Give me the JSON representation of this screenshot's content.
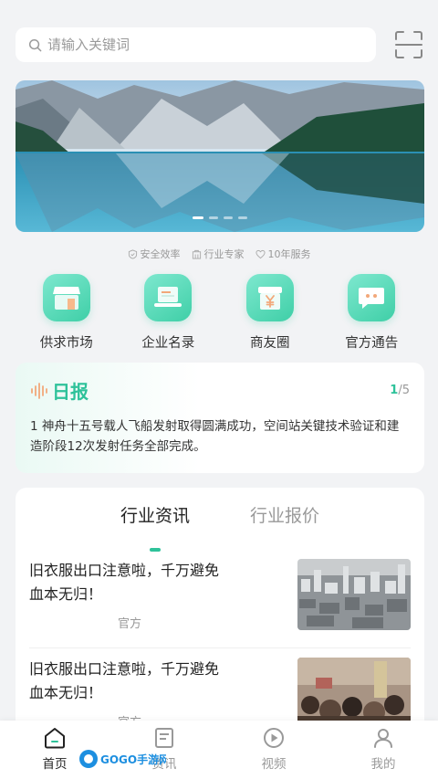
{
  "search": {
    "placeholder": "请输入关键词",
    "scan_icon": "scan-icon"
  },
  "banner": {
    "slide_count": 4,
    "active_slide": 1
  },
  "features": [
    {
      "icon": "shield-icon",
      "label": "安全效率"
    },
    {
      "icon": "building-icon",
      "label": "行业专家"
    },
    {
      "icon": "heart-icon",
      "label": "10年服务"
    }
  ],
  "quick_nav": [
    {
      "icon": "store-icon",
      "label": "供求市场"
    },
    {
      "icon": "laptop-icon",
      "label": "企业名录"
    },
    {
      "icon": "yen-icon",
      "label": "商友圈"
    },
    {
      "icon": "chat-icon",
      "label": "官方通告"
    }
  ],
  "daily": {
    "title": "日报",
    "page_current": "1",
    "page_total": "/5",
    "text": "1 神舟十五号载人飞船发射取得圆满成功，空间站关键技术验证和建造阶段12次发射任务全部完成。"
  },
  "news": {
    "tabs": [
      {
        "label": "行业资讯",
        "active": true
      },
      {
        "label": "行业报价",
        "active": false
      }
    ],
    "items": [
      {
        "title": "旧衣服出口注意啦，千万避免血本无归！",
        "source": "官方"
      },
      {
        "title": "旧衣服出口注意啦，千万避免血本无归！",
        "source": "官方"
      }
    ]
  },
  "tabbar": [
    {
      "icon": "home-icon",
      "label": "首页",
      "active": true
    },
    {
      "icon": "news-icon",
      "label": "资讯",
      "active": false
    },
    {
      "icon": "video-icon",
      "label": "视频",
      "active": false
    },
    {
      "icon": "user-icon",
      "label": "我的",
      "active": false
    }
  ],
  "colors": {
    "accent": "#2ec29a",
    "background": "#f2f3f5"
  }
}
